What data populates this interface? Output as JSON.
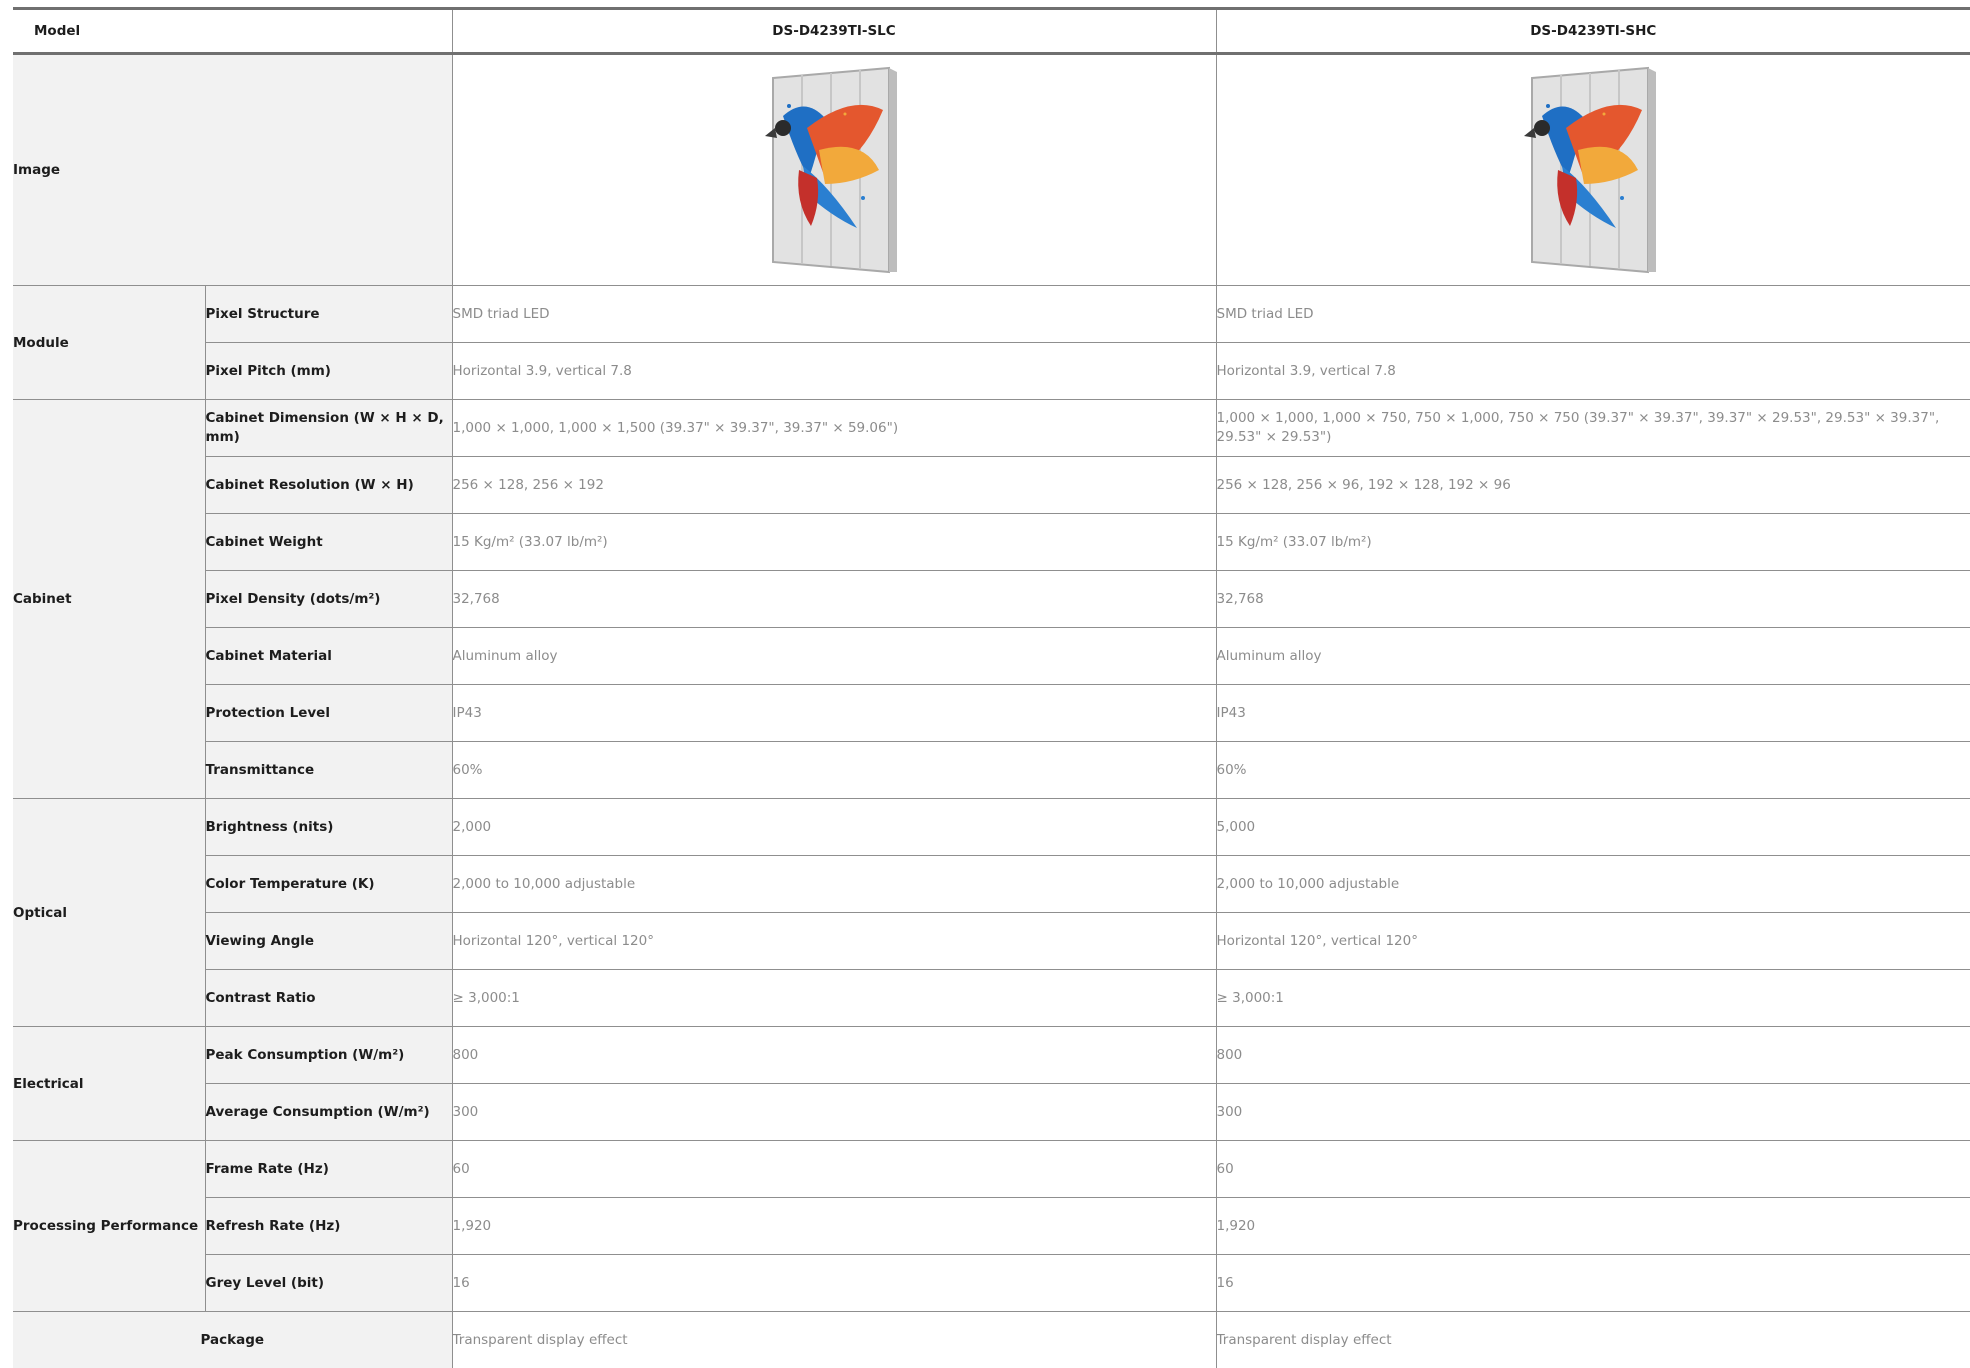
{
  "header": {
    "model_label": "Model",
    "models": [
      "DS-D4239TI-SLC",
      "DS-D4239TI-SHC"
    ]
  },
  "image_row": {
    "label": "Image",
    "product_image_names": [
      "transparent-led-display-parrot-image",
      "transparent-led-display-parrot-image"
    ]
  },
  "sections": [
    {
      "category": "Module",
      "rows": [
        {
          "label": "Pixel Structure",
          "values": [
            "SMD triad LED",
            "SMD triad LED"
          ]
        },
        {
          "label": "Pixel Pitch (mm)",
          "values": [
            "Horizontal 3.9, vertical 7.8",
            "Horizontal 3.9, vertical 7.8"
          ]
        }
      ]
    },
    {
      "category": "Cabinet",
      "rows": [
        {
          "label": "Cabinet Dimension (W × H × D, mm)",
          "values": [
            "1,000 × 1,000, 1,000 × 1,500 (39.37\" × 39.37\", 39.37\" × 59.06\")",
            "1,000 × 1,000, 1,000 × 750, 750 × 1,000, 750 × 750 (39.37\" × 39.37\", 39.37\" × 29.53\", 29.53\" × 39.37\", 29.53\" × 29.53\")"
          ]
        },
        {
          "label": "Cabinet Resolution (W × H)",
          "values": [
            "256 × 128, 256 × 192",
            "256 × 128, 256 × 96, 192 × 128, 192 × 96"
          ]
        },
        {
          "label": "Cabinet Weight",
          "values": [
            "15 Kg/m² (33.07 lb/m²)",
            "15 Kg/m² (33.07 lb/m²)"
          ]
        },
        {
          "label": "Pixel Density (dots/m²)",
          "values": [
            "32,768",
            "32,768"
          ]
        },
        {
          "label": "Cabinet Material",
          "values": [
            "Aluminum alloy",
            "Aluminum alloy"
          ]
        },
        {
          "label": "Protection Level",
          "values": [
            "IP43",
            "IP43"
          ]
        },
        {
          "label": "Transmittance",
          "values": [
            "60%",
            "60%"
          ]
        }
      ]
    },
    {
      "category": "Optical",
      "rows": [
        {
          "label": "Brightness (nits)",
          "values": [
            "2,000",
            "5,000"
          ]
        },
        {
          "label": "Color Temperature (K)",
          "values": [
            "2,000 to 10,000 adjustable",
            "2,000 to 10,000 adjustable"
          ]
        },
        {
          "label": "Viewing Angle",
          "values": [
            "Horizontal 120°, vertical 120°",
            "Horizontal 120°, vertical 120°"
          ]
        },
        {
          "label": "Contrast Ratio",
          "values": [
            "≥ 3,000:1",
            "≥ 3,000:1"
          ]
        }
      ]
    },
    {
      "category": "Electrical",
      "rows": [
        {
          "label": "Peak Consumption (W/m²)",
          "values": [
            "800",
            "800"
          ]
        },
        {
          "label": "Average Consumption (W/m²)",
          "values": [
            "300",
            "300"
          ]
        }
      ]
    },
    {
      "category": "Processing Performance",
      "rows": [
        {
          "label": "Frame Rate (Hz)",
          "values": [
            "60",
            "60"
          ]
        },
        {
          "label": "Refresh Rate (Hz)",
          "values": [
            "1,920",
            "1,920"
          ]
        },
        {
          "label": "Grey Level (bit)",
          "values": [
            "16",
            "16"
          ]
        }
      ]
    }
  ],
  "package": {
    "label": "Package",
    "values": [
      "Transparent display effect",
      "Transparent display effect"
    ]
  }
}
